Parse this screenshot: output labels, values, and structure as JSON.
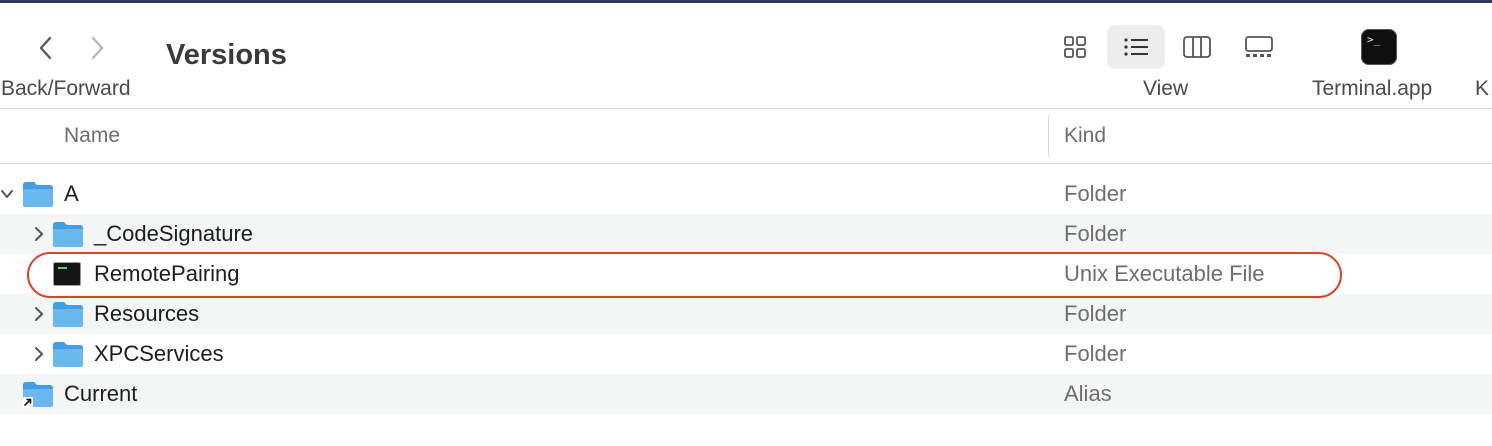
{
  "toolbar": {
    "back_forward_label": "Back/Forward",
    "title": "Versions",
    "view_label": "View",
    "terminal_label": "Terminal.app",
    "terminal_glyph": ">_",
    "cut_label": "K"
  },
  "columns": {
    "name": "Name",
    "kind": "Kind"
  },
  "rows": [
    {
      "name": "A",
      "kind": "Folder",
      "icon": "folder-icon",
      "disclosure": "expanded"
    },
    {
      "name": "_CodeSignature",
      "kind": "Folder",
      "icon": "folder-icon",
      "disclosure": "collapsed"
    },
    {
      "name": "RemotePairing",
      "kind": "Unix Executable File",
      "icon": "executable-icon",
      "disclosure": "none",
      "highlighted": true
    },
    {
      "name": "Resources",
      "kind": "Folder",
      "icon": "folder-icon",
      "disclosure": "collapsed"
    },
    {
      "name": "XPCServices",
      "kind": "Folder",
      "icon": "folder-icon",
      "disclosure": "collapsed"
    },
    {
      "name": "Current",
      "kind": "Alias",
      "icon": "alias-folder-icon",
      "disclosure": "none"
    }
  ],
  "colors": {
    "highlight": "#d8432c",
    "folder": "#5aaee9"
  }
}
